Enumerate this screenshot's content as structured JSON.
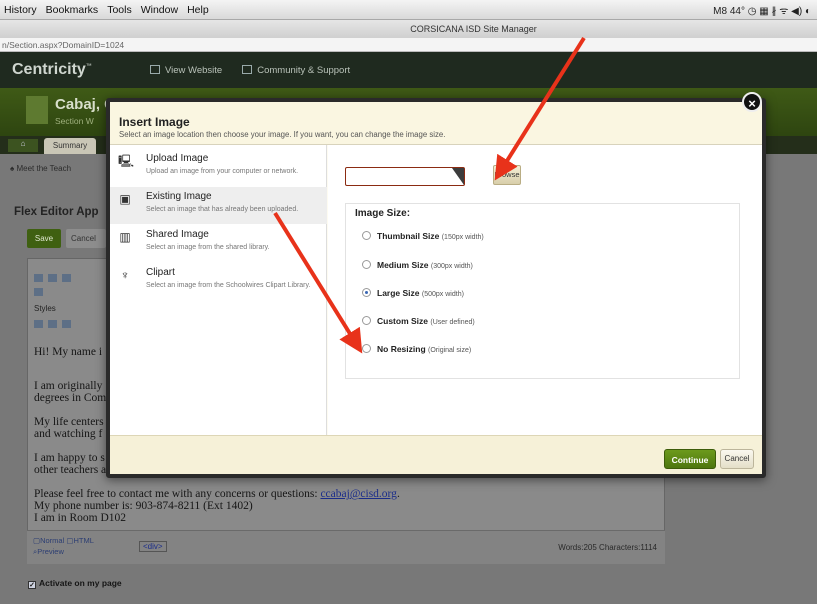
{
  "browser": {
    "menus": [
      "History",
      "Bookmarks",
      "Tools",
      "Window",
      "Help"
    ],
    "status": "M8 44° ◷ ▦ ∦ ᯤ ◀) ◐",
    "window_title": "CORSICANA ISD Site Manager",
    "url": "n/Section.aspx?DomainID=1024"
  },
  "app": {
    "logo": "Centricity",
    "logo_mark": "™",
    "nav": [
      "View Website",
      "Community & Support"
    ],
    "section_name": "Cabaj, C",
    "section_sub": "Section W",
    "tab_home": "⌂",
    "tab_summary": "Summary",
    "breadcrumb": "♠ Meet the Teach",
    "flex_editor": "Flex Editor App",
    "save": "Save",
    "cancel": "Cancel",
    "styles": "Styles"
  },
  "editor": {
    "line1": "Hi! My name i",
    "line2a": "I am originally",
    "line2b": "degrees in Com",
    "line3a": "My life centers",
    "line3b": "and watching f",
    "line4a": "I am happy to s",
    "line4b": "other teachers a",
    "contact_text": "Please feel free to contact me with any concerns or questions: ",
    "contact_link": "ccabaj@cisd.org",
    "contact_end": ".",
    "phone": "My phone number is: 903-874-8211 (Ext 1402)",
    "room": "I am in Room D102",
    "mode_normal": "Normal",
    "mode_html": "HTML",
    "mode_preview": "Preview",
    "div_tag": "<div>",
    "counts": "Words:205 Characters:1114",
    "activate": "Activate on my page"
  },
  "modal": {
    "title": "Insert Image",
    "subtitle": "Select an image location then choose your image. If you want, you can change the image size.",
    "close": "×",
    "options": [
      {
        "title": "Upload Image",
        "desc": "Upload an image from your computer or network."
      },
      {
        "title": "Existing Image",
        "desc": "Select an image that has already been uploaded."
      },
      {
        "title": "Shared Image",
        "desc": "Select an image from the shared library."
      },
      {
        "title": "Clipart",
        "desc": "Select an image from the Schoolwires Clipart Library."
      }
    ],
    "browse": "Browse",
    "size_label": "Image Size:",
    "sizes": [
      {
        "name": "Thumbnail Size",
        "note": "(150px width)"
      },
      {
        "name": "Medium Size",
        "note": "(300px width)"
      },
      {
        "name": "Large Size",
        "note": "(500px width)"
      },
      {
        "name": "Custom Size",
        "note": "(User defined)"
      },
      {
        "name": "No Resizing",
        "note": "(Original size)"
      }
    ],
    "selected_size": "Large Size",
    "continue": "Continue",
    "cancel": "Cancel"
  },
  "colors": {
    "annotation_arrow": "#e8321a",
    "continue_button": "#5b8716",
    "header_green": "#3f5a16"
  }
}
